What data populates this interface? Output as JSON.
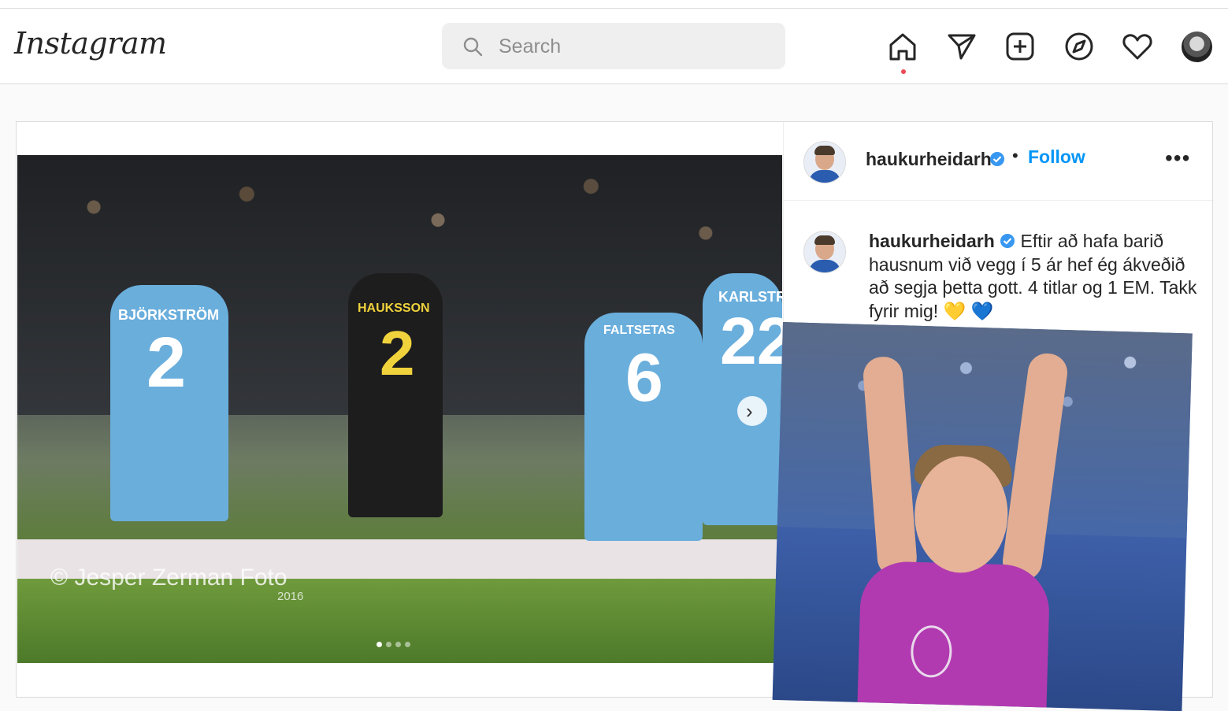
{
  "app": {
    "name": "Instagram"
  },
  "navbar": {
    "logo_text": "Instagram",
    "search_placeholder": "Search",
    "icons": [
      "home-icon",
      "direct-icon",
      "new-post-icon",
      "explore-icon",
      "activity-icon",
      "profile-avatar"
    ],
    "notification_color": "#ed4956"
  },
  "post": {
    "image": {
      "watermark": "© Jesper Zerman Foto",
      "watermark_year": "2016",
      "shirt_names": [
        "BJÖRKSTRÖM",
        "HAUKSSON",
        "FALTSETAS",
        "KARLSTRÖM"
      ],
      "shirt_numbers": [
        "2",
        "2",
        "6",
        "22"
      ],
      "carousel_total": 4,
      "carousel_current": 1
    },
    "header": {
      "username": "haukurheidarh",
      "separator": "•",
      "follow_label": "Follow",
      "more_label": "•••"
    },
    "caption": {
      "username": "haukurheidarh",
      "text": "Eftir að hafa barið hausnum við vegg í 5 ár hef ég ákveðið að segja þetta gott. 4 titlar og 1 EM. Takk fyrir mig! 💛 💙"
    }
  },
  "colors": {
    "accent": "#0095f6",
    "verified": "#3897f0",
    "text": "#262626",
    "border": "#dbdbdb"
  }
}
